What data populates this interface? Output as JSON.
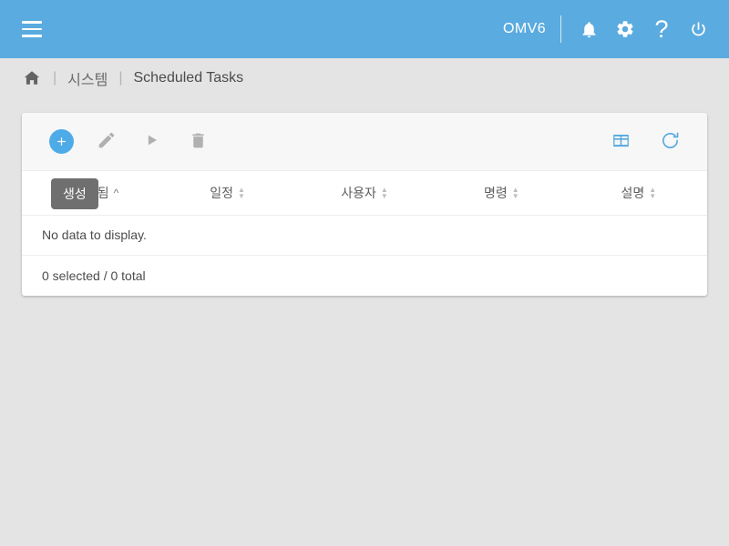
{
  "topbar": {
    "menu_icon": "hamburger-menu-icon",
    "brand": "OMV6",
    "icons": [
      {
        "name": "notifications-icon",
        "glyph": "bell"
      },
      {
        "name": "settings-icon",
        "glyph": "gear"
      },
      {
        "name": "help-icon",
        "glyph": "question-mark"
      },
      {
        "name": "power-icon",
        "glyph": "power"
      }
    ],
    "accent_color": "#5aabdf"
  },
  "breadcrumb": {
    "home_icon": "home-icon",
    "separator": "|",
    "parent": "시스템",
    "current": "Scheduled Tasks"
  },
  "toolbar": {
    "add_label": "생성",
    "edit_label": "편집",
    "run_label": "실행",
    "delete_label": "삭제",
    "columns_label": "열",
    "reload_label": "새로 고침"
  },
  "tooltip": {
    "visible": true,
    "text": "생성"
  },
  "table": {
    "columns": [
      {
        "label": "활성화됨",
        "sort": "asc"
      },
      {
        "label": "일정",
        "sort": "none"
      },
      {
        "label": "사용자",
        "sort": "none"
      },
      {
        "label": "명령",
        "sort": "none"
      },
      {
        "label": "설명",
        "sort": "none"
      }
    ],
    "rows": [],
    "empty_message": "No data to display.",
    "footer": "0 selected / 0 total"
  },
  "colors": {
    "accent": "#5aabdf",
    "page_background": "#e4e4e4",
    "card_background": "#ffffff",
    "toolbar_background": "#f7f7f7",
    "tooltip_background": "#6f6f6f",
    "disabled_icon": "#b0b0b0"
  }
}
